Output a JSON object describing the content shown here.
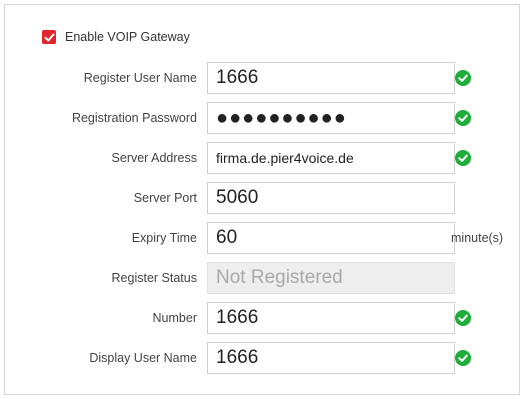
{
  "enable": {
    "label": "Enable VOIP Gateway",
    "checked": true,
    "color": "#e0262b"
  },
  "fields": {
    "register_user_name": {
      "label": "Register User Name",
      "value": "1666",
      "valid": true
    },
    "registration_password": {
      "label": "Registration Password",
      "value": "●●●●●●●●●●",
      "valid": true
    },
    "server_address": {
      "label": "Server Address",
      "value": "firma.de.pier4voice.de",
      "valid": true
    },
    "server_port": {
      "label": "Server Port",
      "value": "5060"
    },
    "expiry_time": {
      "label": "Expiry Time",
      "value": "60",
      "unit": "minute(s)"
    },
    "register_status": {
      "label": "Register Status",
      "value": "Not Registered",
      "disabled": true
    },
    "number": {
      "label": "Number",
      "value": "1666",
      "valid": true
    },
    "display_user_name": {
      "label": "Display User Name",
      "value": "1666",
      "valid": true
    }
  },
  "icons": {
    "valid": "check-circle-icon",
    "valid_color": "#1fae3a"
  }
}
